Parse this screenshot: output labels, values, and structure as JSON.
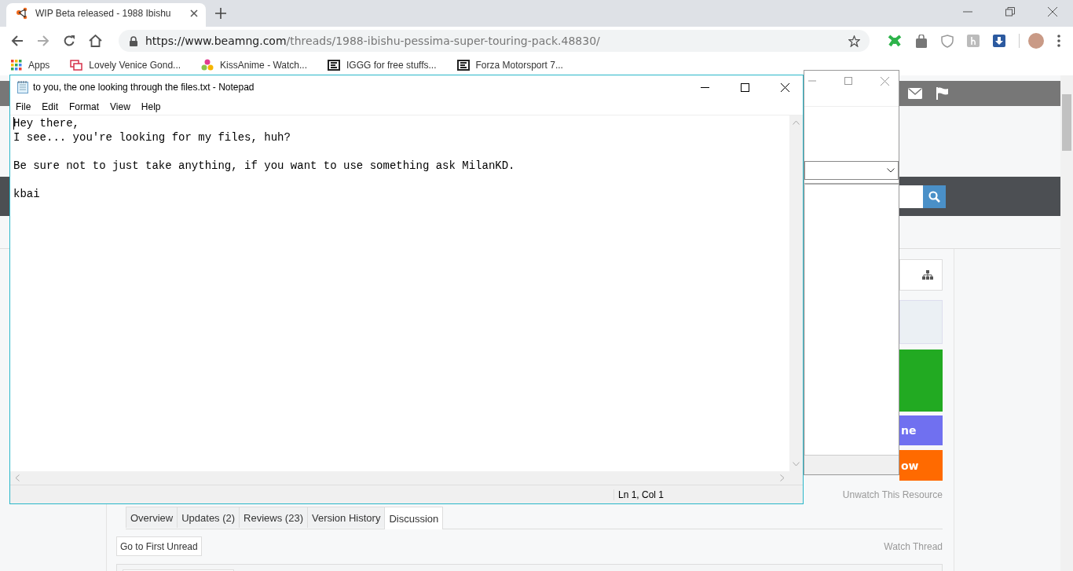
{
  "browser": {
    "tab": {
      "title": "WIP Beta released - 1988 Ibishu",
      "selected": true
    },
    "url_host": "https://www.beamng.com",
    "url_path": "/threads/1988-ibishu-pessima-super-touring-pack.48830/",
    "bookmarks": [
      {
        "label": "Apps",
        "kind": "apps"
      },
      {
        "label": "Lovely Venice Gond...",
        "kind": "screen"
      },
      {
        "label": "KissAnime - Watch...",
        "kind": "flower"
      },
      {
        "label": "IGGG for free stuffs...",
        "kind": "logo"
      },
      {
        "label": "Forza Motorsport 7...",
        "kind": "logo"
      }
    ]
  },
  "page": {
    "sidebar_buttons": [
      {
        "label": "ne",
        "color": "#7070f0"
      },
      {
        "label": "ow",
        "color": "#ff6a00"
      }
    ],
    "unwatch_link": "Unwatch This Resource",
    "tabs": [
      {
        "label": "Overview",
        "selected": false
      },
      {
        "label": "Updates (2)",
        "selected": false
      },
      {
        "label": "Reviews (23)",
        "selected": false
      },
      {
        "label": "Version History",
        "selected": false
      },
      {
        "label": "Discussion",
        "selected": true
      }
    ],
    "first_unread_button": "Go to First Unread",
    "watch_link": "Watch Thread"
  },
  "notepad": {
    "title": "to you, the one looking through the files.txt - Notepad",
    "menu": [
      "File",
      "Edit",
      "Format",
      "View",
      "Help"
    ],
    "content": "Hey there,\nI see... you're looking for my files, huh?\n\nBe sure not to just take anything, if you want to use something ask MilanKD.\n\nkbai",
    "status": "Ln 1, Col 1"
  }
}
